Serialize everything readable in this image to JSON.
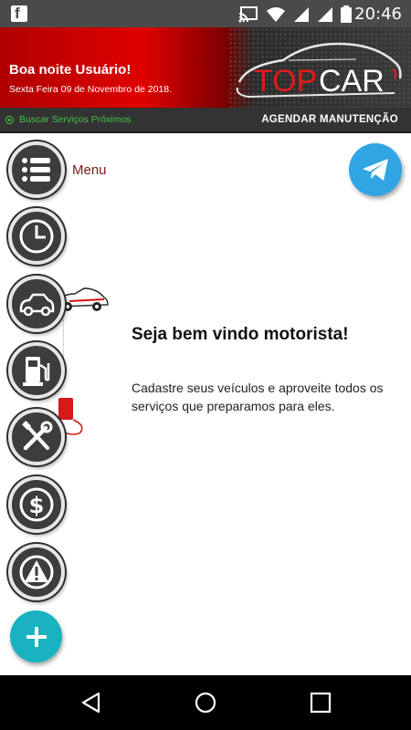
{
  "status_bar": {
    "time": "20:46",
    "left_app_icon": "facebook-icon",
    "icons": [
      "cast-icon",
      "wifi-icon",
      "signal-icon",
      "signal-icon",
      "battery-icon"
    ]
  },
  "header": {
    "greeting": "Boa noite Usuário!",
    "date": "Sexta Feira 09 de Novembro de 2018.",
    "logo": {
      "top": "TOP",
      "bottom": "CAR"
    }
  },
  "subbar": {
    "nearby_label": "Buscar Serviços Próximos",
    "schedule_label": "AGENDAR MANUTENÇÃO"
  },
  "side_menu": {
    "label": "Menu",
    "items": [
      {
        "icon": "list-icon"
      },
      {
        "icon": "clock-icon"
      },
      {
        "icon": "car-icon"
      },
      {
        "icon": "fuel-pump-icon"
      },
      {
        "icon": "tools-icon"
      },
      {
        "icon": "dollar-icon"
      },
      {
        "icon": "warning-icon"
      }
    ]
  },
  "main": {
    "title": "Seja bem vindo motorista!",
    "description": "Cadastre seus veículos e aproveite todos os serviços que preparamos para eles."
  },
  "colors": {
    "header_red": "#e00000",
    "accent_green": "#49c24a",
    "fab": "#19b3bf",
    "telegram": "#2fa6e3",
    "menu_dark": "#3d3d3d"
  },
  "navbar": {
    "icons": [
      "back-icon",
      "home-icon",
      "recents-icon"
    ]
  }
}
